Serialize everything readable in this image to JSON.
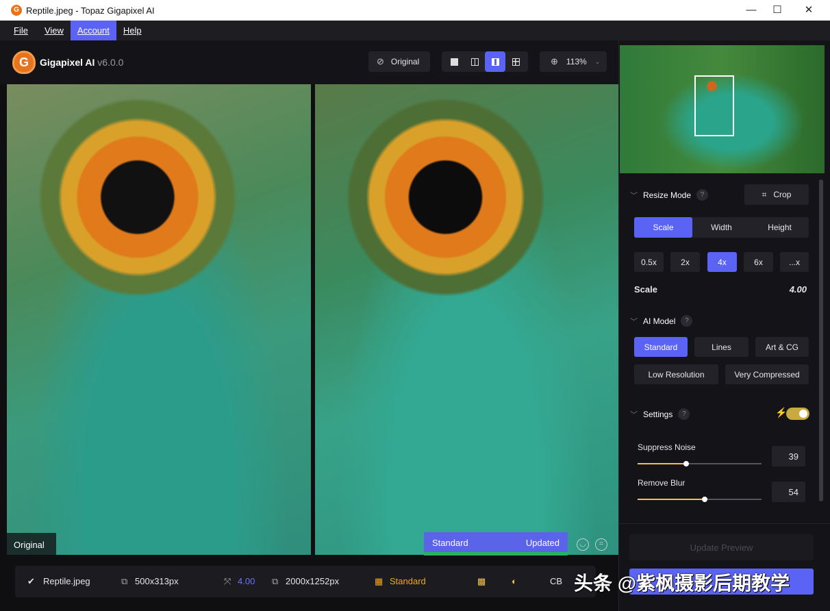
{
  "window": {
    "title": "Reptile.jpeg - Topaz Gigapixel AI",
    "app_icon": "G",
    "minimize": "—",
    "maximize": "☐",
    "close": "✕"
  },
  "menu": [
    {
      "label": "File"
    },
    {
      "label": "View"
    },
    {
      "label": "Account",
      "active": true
    },
    {
      "label": "Help"
    }
  ],
  "header": {
    "logo_letter": "G",
    "app_name": "Gigapixel AI",
    "version": "v6.0.0",
    "original_label": "Original",
    "zoom": "113%",
    "view_modes": [
      "single",
      "split",
      "side-by-side",
      "grid"
    ],
    "active_view": "side-by-side"
  },
  "preview": {
    "left_label": "Original",
    "model_label": "Standard",
    "status": "Updated"
  },
  "bottom": {
    "filename": "Reptile.jpeg",
    "input_size": "500x313px",
    "scale": "4.00",
    "output_size": "2000x1252px",
    "model": "Standard",
    "cb": "CB"
  },
  "panel": {
    "resize_mode": {
      "title": "Resize Mode",
      "help": "?",
      "crop": "Crop",
      "tabs": [
        "Scale",
        "Width",
        "Height"
      ],
      "active_tab": "Scale",
      "presets": [
        "0.5x",
        "2x",
        "4x",
        "6x",
        "...x"
      ],
      "active_preset": "4x",
      "scale_label": "Scale",
      "scale_value": "4.00"
    },
    "ai_model": {
      "title": "AI Model",
      "help": "?",
      "models": [
        "Standard",
        "Lines",
        "Art & CG",
        "Low Resolution",
        "Very Compressed"
      ],
      "active": "Standard"
    },
    "settings": {
      "title": "Settings",
      "help": "?",
      "auto_enabled": true,
      "suppress_noise": {
        "label": "Suppress Noise",
        "value": "39"
      },
      "remove_blur": {
        "label": "Remove Blur",
        "value": "54"
      }
    },
    "update_preview": "Update Preview"
  },
  "watermark": "头条 @紫枫摄影后期教学",
  "colors": {
    "accent": "#5b63f5",
    "warning": "#f2a81d",
    "toggle": "#c9aa3f",
    "updated_bar": "#27b35a"
  }
}
